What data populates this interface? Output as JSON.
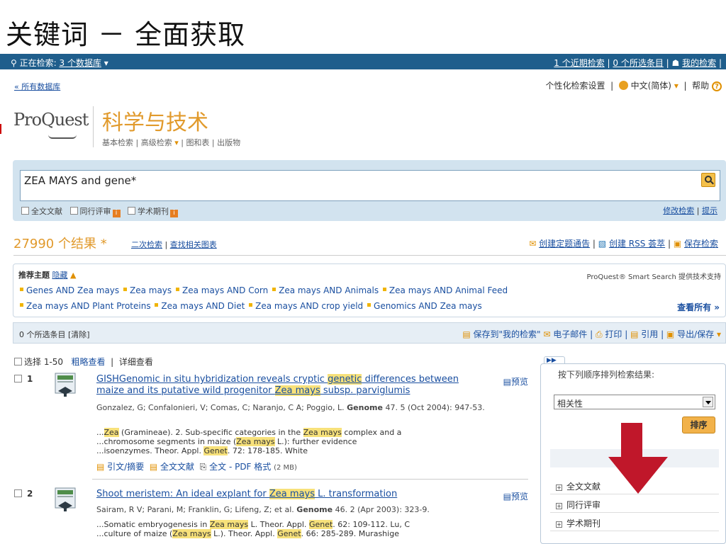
{
  "slide_title": "关键词 － 全面获取",
  "topbar": {
    "searching_label": "正在检索:",
    "db_link": "3 个数据库",
    "recent_searches": "1 个近期检索",
    "selected_items": "0 个所选条目",
    "my_searches": "我的检索"
  },
  "crumb": "« 所有数据库",
  "prefs": {
    "settings": "个性化检索设置",
    "language": "中文(简体)",
    "help": "帮助"
  },
  "logo": "ProQuest",
  "db_name": "科学与技术",
  "subnav": {
    "basic": "基本检索",
    "advanced": "高级检索",
    "figures": "图和表",
    "pubs": "出版物"
  },
  "search": {
    "query": "ZEA MAYS and gene*",
    "full_text": "全文文献",
    "peer_reviewed": "同行评审",
    "scholarly": "学术期刊",
    "modify": "修改检索",
    "tips": "提示"
  },
  "results": {
    "count": "27990 个结果 *",
    "refine": "二次检索",
    "related_figures": "查找相关图表",
    "alert": "创建定题通告",
    "rss": "创建 RSS 荟萃",
    "save": "保存检索"
  },
  "topics": {
    "label": "推荐主题",
    "hide": "隐藏",
    "smart_search": "ProQuest® Smart Search 提供技术支持",
    "row1": [
      "Genes AND Zea mays",
      "Zea mays",
      "Zea mays AND Corn",
      "Zea mays AND Animals",
      "Zea mays AND Animal Feed"
    ],
    "row2": [
      "Zea mays AND Plant Proteins",
      "Zea mays AND Diet",
      "Zea mays AND crop yield",
      "Genomics AND Zea mays"
    ],
    "see_all": "查看所有 »"
  },
  "selection": {
    "label": "0 个所选条目 [清除]",
    "save_to": "保存到\"我的检索\"",
    "email": "电子邮件",
    "print": "打印",
    "cite": "引用",
    "export": "导出/保存"
  },
  "view": {
    "select": "选择 1-50",
    "brief": "粗略查看",
    "detailed": "详细查看"
  },
  "items": [
    {
      "num": "1",
      "title_a": "GISHGenomic in situ hybridization reveals cryptic ",
      "title_h1": "genetic",
      "title_b": " differences between maize and its putative wild progenitor ",
      "title_h2": "Zea mays",
      "title_c": " subsp. parviglumis",
      "preview": "预览",
      "authors": "Gonzalez, G; Confalonieri, V; Comas, C; Naranjo, C A; Poggio, L.",
      "journal": "Genome",
      "citation": "47. 5 (Oct 2004): 947-53.",
      "s1a": "...",
      "s1h": "Zea",
      "s1b": " (Gramineae). 2. Sub-specific categories in the ",
      "s1h2": "Zea mays",
      "s1c": " complex and a",
      "s2a": "...chromosome segments in maize (",
      "s2h": "Zea mays",
      "s2b": " L.): further evidence",
      "s3a": "...isoenzymes. Theor. Appl. ",
      "s3h": "Genet",
      "s3b": ". 72: 178-185. White",
      "link_abstract": "引文/摘要",
      "link_full": "全文文献",
      "link_pdf": "全文 - PDF 格式",
      "pdf_size": "(2 MB)"
    },
    {
      "num": "2",
      "title_a": "Shoot meristem: An ideal explant for ",
      "title_h1": "Zea mays",
      "title_b": " L. transformation",
      "preview": "预览",
      "authors": "Sairam, R V; Parani, M; Franklin, G; Lifeng, Z; et al.",
      "journal": "Genome",
      "citation": "46. 2 (Apr 2003): 323-9.",
      "s1a": "...Somatic embryogenesis in ",
      "s1h": "Zea mays",
      "s1b": " L. Theor. Appl. ",
      "s1h2": "Genet",
      "s1c": ". 62: 109-112. Lu, C",
      "s2a": "...culture of maize (",
      "s2h": "Zea mays",
      "s2b": " L.). Theor. Appl. ",
      "s2h2": "Genet",
      "s2c": ". 66: 285-289. Murashige"
    }
  ],
  "sidebar": {
    "sort_label": "按下列顺序排列检索结果:",
    "sort_value": "相关性",
    "sort_button": "排序",
    "facets": [
      "全文文献",
      "同行评审",
      "学术期刊"
    ]
  },
  "colors": {
    "topbar": "#1f5e8c",
    "accent": "#e19a2c",
    "highlight": "#f7e17a",
    "arrow": "#c0172a"
  }
}
